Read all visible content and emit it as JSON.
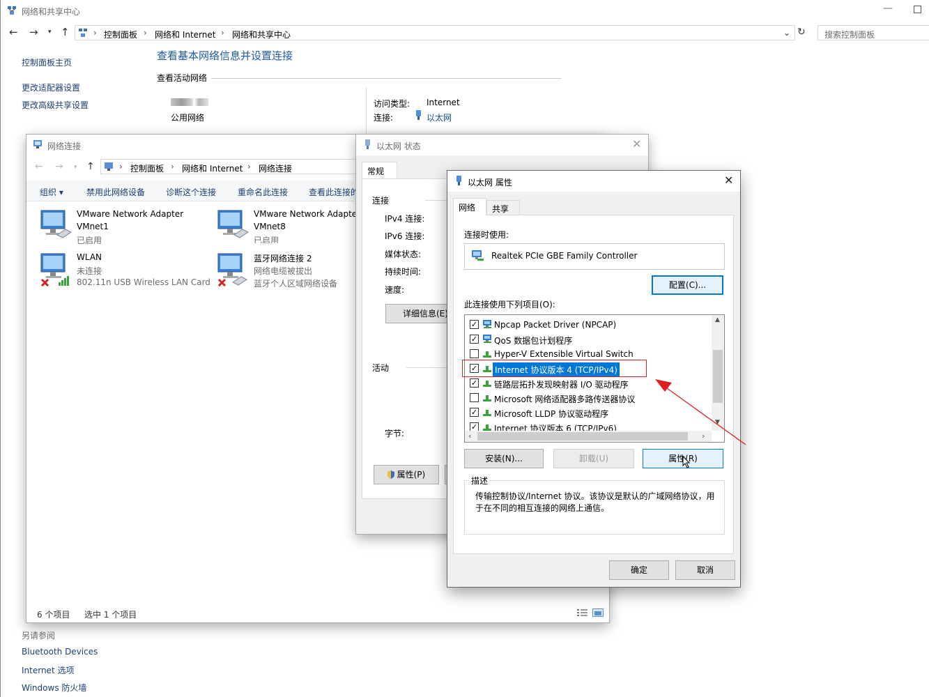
{
  "main": {
    "title": "网络和共享中心",
    "address": [
      "控制面板",
      "网络和 Internet",
      "网络和共享中心"
    ],
    "search_placeholder": "搜索控制面板",
    "sidebar": {
      "home": "控制面板主页",
      "items": [
        "更改适配器设置",
        "更改高级共享设置"
      ],
      "see_also_label": "另请参阅",
      "see_also": [
        "Bluetooth Devices",
        "Internet 选项",
        "Windows 防火墙"
      ]
    },
    "heading": "查看基本网络信息并设置连接",
    "active_label": "查看活动网络",
    "network_type": "公用网络",
    "access_type_label": "访问类型:",
    "access_type_value": "Internet",
    "connection_label": "连接:",
    "connection_value": "以太网"
  },
  "netconn": {
    "title": "网络连接",
    "address": [
      "控制面板",
      "网络和 Internet",
      "网络连接"
    ],
    "toolbar": [
      "组织 ▾",
      "禁用此网络设备",
      "诊断这个连接",
      "重命名此连接",
      "查看此连接的"
    ],
    "adapters": [
      {
        "name": "VMware Network Adapter",
        "line2": "VMnet1",
        "status": "已启用"
      },
      {
        "name": "VMware Network Adapte",
        "line2": "VMnet8",
        "status": "已启用"
      },
      {
        "name": "WLAN",
        "line2": "未连接",
        "status": "802.11n USB Wireless LAN Card"
      },
      {
        "name": "蓝牙网络连接 2",
        "line2": "网络电缆被拔出",
        "status": "蓝牙个人区域网络设备"
      }
    ],
    "status_count": "6 个项目",
    "status_selected": "选中 1 个项目"
  },
  "status_dlg": {
    "title": "以太网 状态",
    "tab": "常规",
    "section_conn": "连接",
    "rows": [
      "IPv4 连接:",
      "IPv6 连接:",
      "媒体状态:",
      "持续时间:",
      "速度:"
    ],
    "details_btn": "详细信息(E)",
    "section_activity": "活动",
    "bytes_label": "字节:",
    "props_btn": "属性(P)"
  },
  "props_dlg": {
    "title": "以太网 属性",
    "tabs": [
      "网络",
      "共享"
    ],
    "connect_using_label": "连接时使用:",
    "adapter_name": "Realtek PCIe GBE Family Controller",
    "config_btn": "配置(C)...",
    "items_label": "此连接使用下列项目(O):",
    "items": [
      {
        "label": "Npcap Packet Driver (NPCAP)",
        "checked": true
      },
      {
        "label": "QoS 数据包计划程序",
        "checked": true
      },
      {
        "label": "Hyper-V Extensible Virtual Switch",
        "checked": false
      },
      {
        "label": "Internet 协议版本 4 (TCP/IPv4)",
        "checked": true
      },
      {
        "label": "链路层拓扑发现映射器 I/O 驱动程序",
        "checked": true
      },
      {
        "label": "Microsoft 网络适配器多路传送器协议",
        "checked": false
      },
      {
        "label": "Microsoft LLDP 协议驱动程序",
        "checked": true
      },
      {
        "label": "Internet 协议版本 6 (TCP/IPv6)",
        "checked": true
      }
    ],
    "install_btn": "安装(N)...",
    "uninstall_btn": "卸载(U)",
    "properties_btn": "属性(R)",
    "desc_label": "描述",
    "desc_text": "传输控制协议/Internet 协议。该协议是默认的广域网络协议，用于在不同的相互连接的网络上通信。",
    "ok_btn": "确定",
    "cancel_btn": "取消"
  },
  "colors": {
    "link": "#0b50a0",
    "heading": "#1e5aa8",
    "highlight": "#0078d7",
    "annotation": "#e02020"
  }
}
